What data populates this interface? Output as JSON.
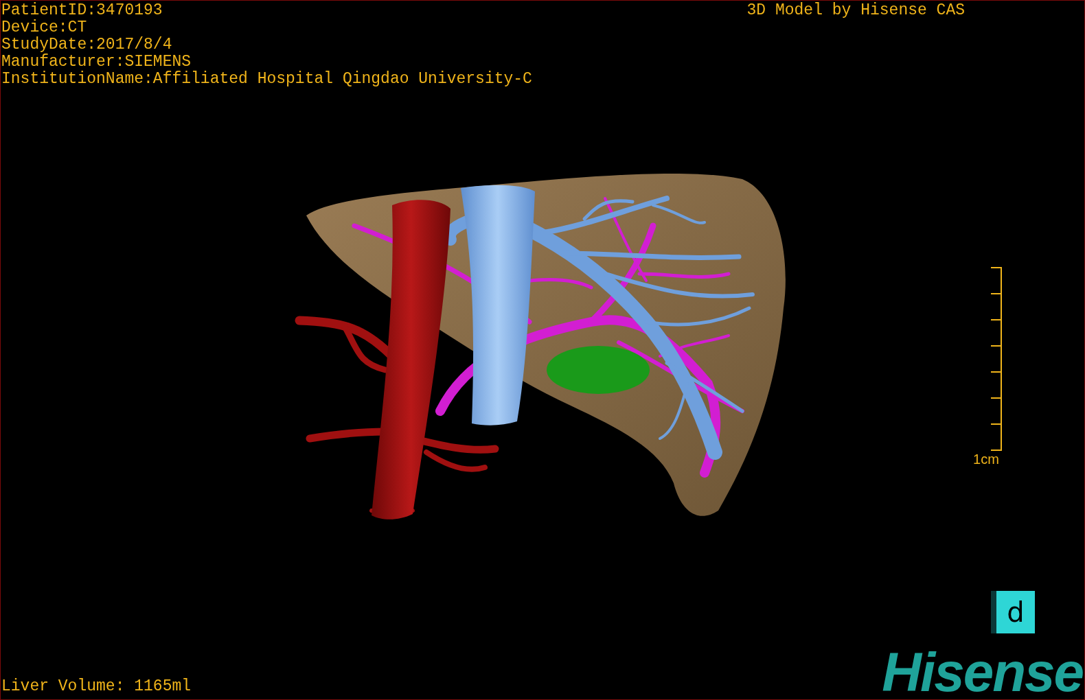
{
  "patient_info": [
    "PatientID:3470193",
    "Device:CT",
    "StudyDate:2017/8/4",
    "Manufacturer:SIEMENS",
    "InstitutionName:Affiliated Hospital Qingdao University-C"
  ],
  "title": "3D Model by Hisense CAS",
  "scale_bar": {
    "label": "1cm"
  },
  "orientation_cube": {
    "face_label": "d"
  },
  "liver_volume": "Liver Volume: 1165ml",
  "logo": "Hisense"
}
